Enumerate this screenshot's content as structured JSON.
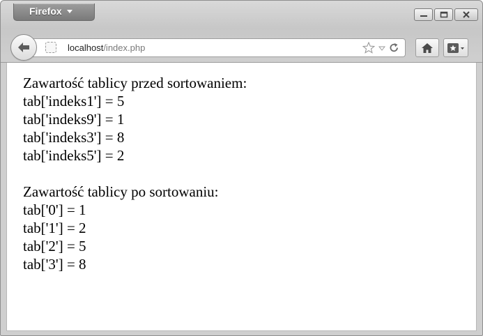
{
  "browser": {
    "app_menu_label": "Firefox",
    "window_controls": {
      "minimize_icon": "minimize-icon",
      "maximize_icon": "maximize-icon",
      "close_icon": "close-icon"
    }
  },
  "toolbar": {
    "url_host": "localhost",
    "url_path": "/index.php",
    "icons": [
      "back-arrow-icon",
      "site-identity-icon",
      "bookmark-star-icon",
      "history-dropdown-icon",
      "reload-icon",
      "home-icon",
      "bookmarks-menu-icon"
    ]
  },
  "page": {
    "before_title": "Zawartość tablicy przed sortowaniem:",
    "before_lines": [
      "tab['indeks1'] = 5",
      "tab['indeks9'] = 1",
      "tab['indeks3'] = 8",
      "tab['indeks5'] = 2"
    ],
    "after_title": "Zawartość tablicy po sortowaniu:",
    "after_lines": [
      "tab['0'] = 1",
      "tab['1'] = 2",
      "tab['2'] = 5",
      "tab['3'] = 8"
    ]
  }
}
